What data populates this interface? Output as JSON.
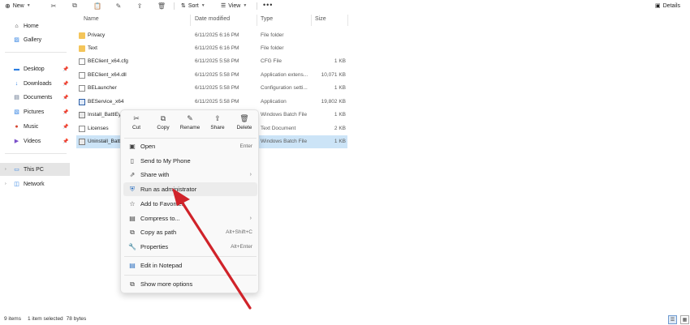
{
  "toolbar": {
    "new_label": "New",
    "sort_label": "Sort",
    "view_label": "View",
    "more_label": "•••",
    "details_label": "Details"
  },
  "sidebar": {
    "items": [
      {
        "label": "Home",
        "icon": "home-icon"
      },
      {
        "label": "Gallery",
        "icon": "gallery-icon"
      },
      {
        "label": "Desktop",
        "icon": "desktop-icon",
        "pinned": true
      },
      {
        "label": "Downloads",
        "icon": "download-icon",
        "pinned": true
      },
      {
        "label": "Documents",
        "icon": "documents-icon",
        "pinned": true
      },
      {
        "label": "Pictures",
        "icon": "pictures-icon",
        "pinned": true
      },
      {
        "label": "Music",
        "icon": "music-icon",
        "pinned": true
      },
      {
        "label": "Videos",
        "icon": "videos-icon",
        "pinned": true
      },
      {
        "label": "This PC",
        "icon": "pc-icon",
        "selected": true
      },
      {
        "label": "Network",
        "icon": "network-icon"
      }
    ]
  },
  "columns": {
    "name": "Name",
    "date": "Date modified",
    "type": "Type",
    "size": "Size"
  },
  "files": [
    {
      "name": "Privacy",
      "date": "6/11/2025 6:16 PM",
      "type": "File folder",
      "size": "",
      "icon": "folder"
    },
    {
      "name": "Text",
      "date": "6/11/2025 6:16 PM",
      "type": "File folder",
      "size": "",
      "icon": "folder"
    },
    {
      "name": "BEClient_x64.cfg",
      "date": "6/11/2025 5:58 PM",
      "type": "CFG File",
      "size": "1 KB",
      "icon": "doc"
    },
    {
      "name": "BEClient_x64.dll",
      "date": "6/11/2025 5:58 PM",
      "type": "Application extens...",
      "size": "10,071 KB",
      "icon": "doc"
    },
    {
      "name": "BELauncher",
      "date": "6/11/2025 5:58 PM",
      "type": "Configuration setti...",
      "size": "1 KB",
      "icon": "doc"
    },
    {
      "name": "BEService_x64",
      "date": "6/11/2025 5:58 PM",
      "type": "Application",
      "size": "19,802 KB",
      "icon": "app"
    },
    {
      "name": "Install_BattlEy",
      "date": "",
      "type": "Windows Batch File",
      "size": "1 KB",
      "icon": "bat"
    },
    {
      "name": "Licenses",
      "date": "",
      "type": "Text Document",
      "size": "2 KB",
      "icon": "txt"
    },
    {
      "name": "Uninstall_Batt",
      "date": "",
      "type": "Windows Batch File",
      "size": "1 KB",
      "icon": "bat",
      "selected": true
    }
  ],
  "context_menu": {
    "quick_actions": [
      {
        "label": "Cut",
        "icon": "scissors-icon"
      },
      {
        "label": "Copy",
        "icon": "copy-icon"
      },
      {
        "label": "Rename",
        "icon": "rename-icon"
      },
      {
        "label": "Share",
        "icon": "share-icon"
      },
      {
        "label": "Delete",
        "icon": "trash-icon"
      }
    ],
    "items": [
      {
        "label": "Open",
        "shortcut": "Enter",
        "icon": "open-icon"
      },
      {
        "label": "Send to My Phone",
        "shortcut": "",
        "icon": "phone-icon"
      },
      {
        "label": "Share with",
        "shortcut": "",
        "icon": "share-with-icon",
        "submenu": true
      },
      {
        "label": "Run as administrator",
        "shortcut": "",
        "icon": "shield-icon",
        "hover": true
      },
      {
        "label": "Add to Favorites",
        "shortcut": "",
        "icon": "star-icon"
      },
      {
        "label": "Compress to...",
        "shortcut": "",
        "icon": "zip-icon",
        "submenu": true
      },
      {
        "label": "Copy as path",
        "shortcut": "Alt+Shift+C",
        "icon": "path-icon"
      },
      {
        "label": "Properties",
        "shortcut": "Alt+Enter",
        "icon": "wrench-icon"
      },
      {
        "label": "Edit in Notepad",
        "shortcut": "",
        "icon": "notepad-icon"
      },
      {
        "label": "Show more options",
        "shortcut": "",
        "icon": "more-options-icon"
      }
    ]
  },
  "status": {
    "items_count": "9 items",
    "selected_info": "1 item selected",
    "selected_size": "78 bytes"
  },
  "colors": {
    "selection": "#cce4f7",
    "annotation_arrow": "#d0232a"
  }
}
